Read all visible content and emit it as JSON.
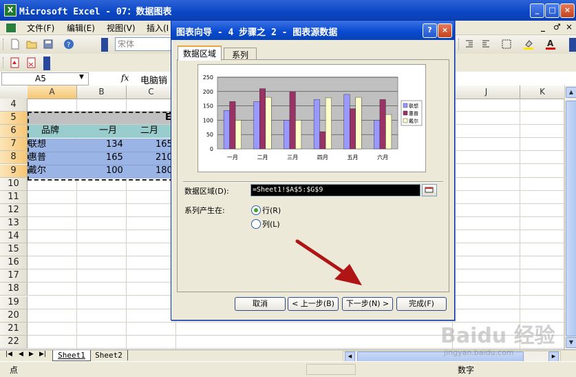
{
  "window": {
    "title": "Microsoft Excel - 07：数据图表",
    "app_icon": "excel-icon",
    "buttons": [
      "_",
      "□",
      "×"
    ]
  },
  "menu": {
    "items": [
      "文件(F)",
      "编辑(E)",
      "视图(V)",
      "插入(I"
    ],
    "doc_buttons": [
      "_",
      "♂",
      "×"
    ]
  },
  "toolbar": {
    "font_name": "宋体"
  },
  "formula_bar": {
    "name_box": "A5",
    "fx": "fx",
    "content": "电脑销"
  },
  "grid": {
    "columns": [
      "A",
      "B",
      "C",
      "J",
      "K"
    ],
    "rows": [
      "4",
      "5",
      "6",
      "7",
      "8",
      "9",
      "10",
      "11",
      "12",
      "13",
      "14",
      "15",
      "16",
      "17",
      "18",
      "19",
      "20",
      "21",
      "22"
    ],
    "row5_text": "E",
    "header_row": [
      "品牌",
      "一月",
      "二月"
    ],
    "data_rows": [
      [
        "联想",
        "134",
        "165"
      ],
      [
        "惠普",
        "165",
        "210"
      ],
      [
        "戴尔",
        "100",
        "180"
      ]
    ]
  },
  "dialog": {
    "title": "图表向导 - 4 步骤之 2 - 图表源数据",
    "help_button": "?",
    "close_button": "×",
    "tabs": [
      "数据区域",
      "系列"
    ],
    "data_range_label": "数据区域(D):",
    "data_range_value": "=Sheet1!$A$5:$G$9",
    "series_in_label": "系列产生在:",
    "radio_row": "行(R)",
    "radio_col": "列(L)",
    "buttons": {
      "cancel": "取消",
      "back": "< 上一步(B)",
      "next": "下一步(N) >",
      "finish": "完成(F)"
    }
  },
  "chart_data": {
    "type": "bar",
    "categories": [
      "一月",
      "二月",
      "三月",
      "四月",
      "五月",
      "六月"
    ],
    "series": [
      {
        "name": "联想",
        "color": "#9999ff",
        "values": [
          134,
          165,
          100,
          172,
          190,
          100
        ]
      },
      {
        "name": "惠普",
        "color": "#993366",
        "values": [
          165,
          210,
          200,
          60,
          140,
          172
        ]
      },
      {
        "name": "戴尔",
        "color": "#ffffcc",
        "values": [
          100,
          180,
          100,
          178,
          180,
          120
        ]
      }
    ],
    "ylim": [
      0,
      250
    ],
    "yticks": [
      "0",
      "50",
      "100",
      "150",
      "200",
      "250"
    ],
    "plot_background": "#c0c0c0",
    "legend_position": "right"
  },
  "sheets": {
    "nav": [
      "|◀",
      "◀",
      "▶",
      "▶|"
    ],
    "tabs": [
      "Sheet1",
      "Sheet2"
    ]
  },
  "status": {
    "left": "点",
    "right": "数字"
  },
  "watermark": {
    "text": "Baidu 经验",
    "url": "jingyan.baidu.com"
  }
}
